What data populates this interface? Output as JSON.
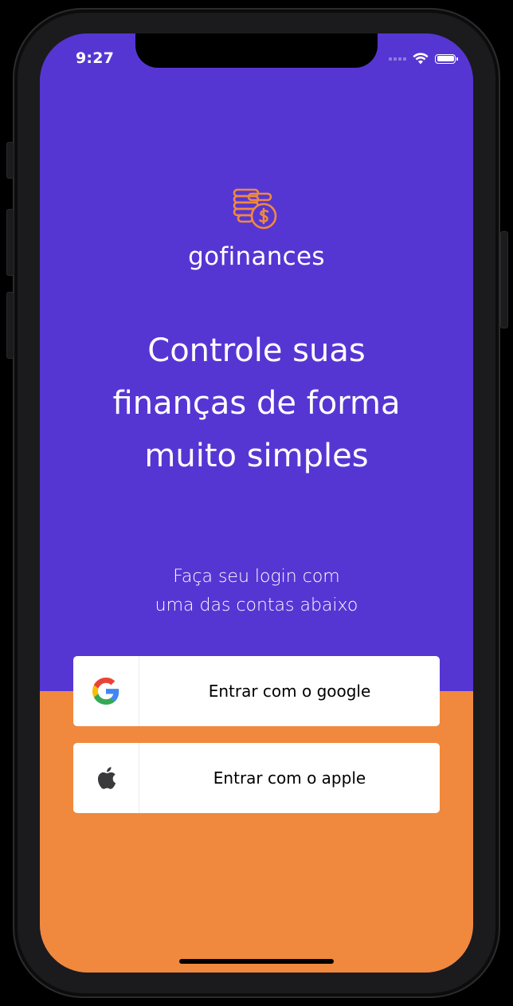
{
  "status_bar": {
    "time": "9:27"
  },
  "brand": {
    "logo_icon": "coins-dollar-icon",
    "name": "gofinances"
  },
  "hero": {
    "headline_lines": [
      "Controle suas",
      "finanças de forma",
      "muito simples"
    ]
  },
  "login": {
    "subtitle_lines": [
      "Faça seu login com",
      "uma das contas abaixo"
    ],
    "google_button": {
      "icon": "google-icon",
      "label": "Entrar com o google"
    },
    "apple_button": {
      "icon": "apple-icon",
      "label": "Entrar com o apple"
    }
  },
  "colors": {
    "primary": "#5636d3",
    "secondary": "#f0893d",
    "surface": "#ffffff",
    "text_on_surface": "#000000"
  }
}
